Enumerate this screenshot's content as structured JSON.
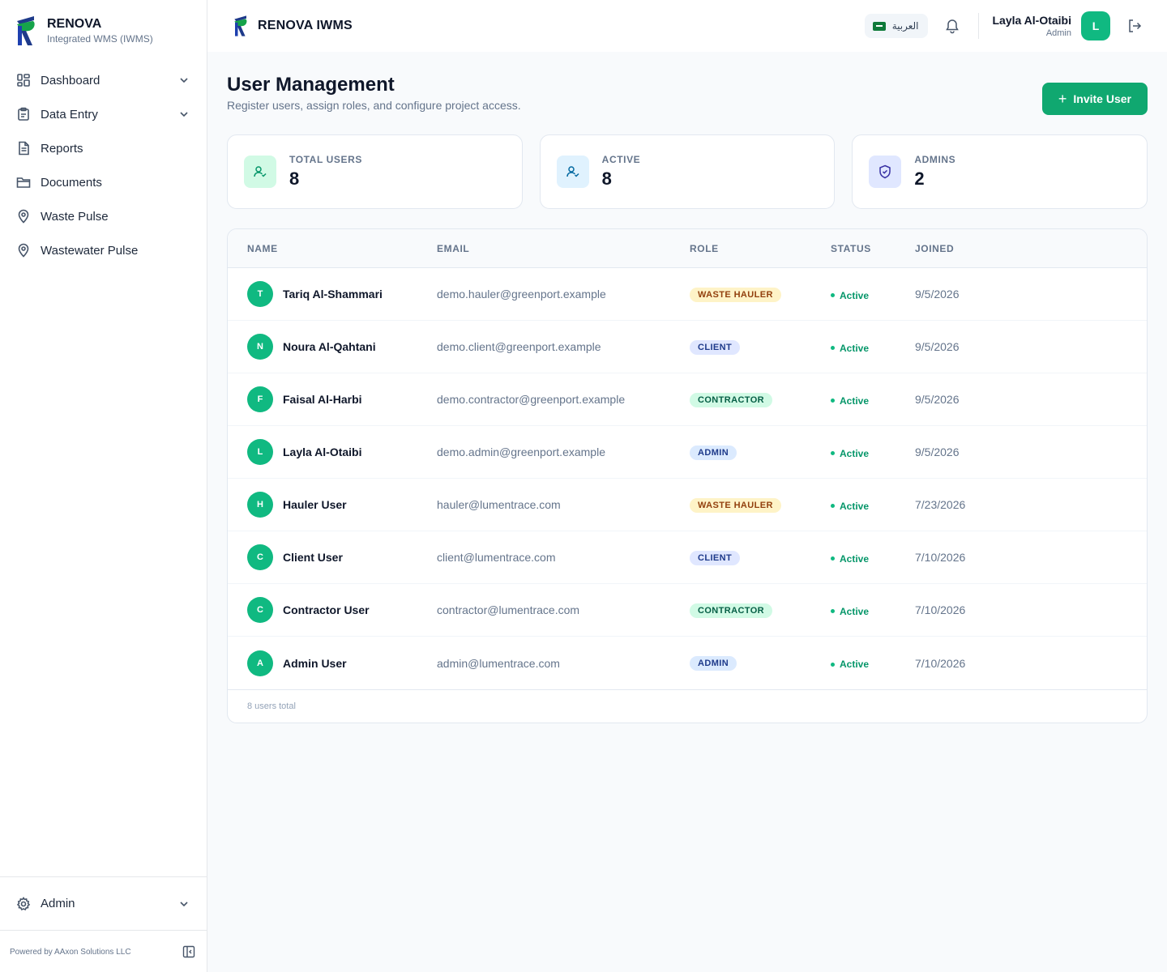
{
  "sidebar": {
    "brand_name": "RENOVA",
    "brand_sub": "Integrated WMS (IWMS)",
    "items": [
      {
        "label": "Dashboard"
      },
      {
        "label": "Data Entry"
      },
      {
        "label": "Reports"
      },
      {
        "label": "Documents"
      },
      {
        "label": "Waste Pulse"
      },
      {
        "label": "Wastewater Pulse"
      }
    ],
    "admin_label": "Admin",
    "footer": "Powered by AAxon Solutions LLC"
  },
  "header": {
    "brand_name": "RENOVA IWMS",
    "language": "العربية",
    "user_name": "Layla Al-Otaibi",
    "user_role": "Admin",
    "avatar_initial": "L"
  },
  "page": {
    "title": "User Management",
    "subtitle": "Register users, assign roles, and configure project access.",
    "invite_label": "Invite User"
  },
  "stats": [
    {
      "label": "TOTAL USERS",
      "value": "8"
    },
    {
      "label": "ACTIVE",
      "value": "8"
    },
    {
      "label": "ADMINS",
      "value": "2"
    }
  ],
  "table": {
    "columns": [
      "NAME",
      "EMAIL",
      "ROLE",
      "STATUS",
      "JOINED"
    ],
    "rows": [
      {
        "initial": "T",
        "name": "Tariq Al-Shammari",
        "email": "demo.hauler@greenport.example",
        "role": "WASTE HAULER",
        "status": "Active",
        "joined": "9/5/2026"
      },
      {
        "initial": "N",
        "name": "Noura Al-Qahtani",
        "email": "demo.client@greenport.example",
        "role": "CLIENT",
        "status": "Active",
        "joined": "9/5/2026"
      },
      {
        "initial": "F",
        "name": "Faisal Al-Harbi",
        "email": "demo.contractor@greenport.example",
        "role": "CONTRACTOR",
        "status": "Active",
        "joined": "9/5/2026"
      },
      {
        "initial": "L",
        "name": "Layla Al-Otaibi",
        "email": "demo.admin@greenport.example",
        "role": "ADMIN",
        "status": "Active",
        "joined": "9/5/2026"
      },
      {
        "initial": "H",
        "name": "Hauler User",
        "email": "hauler@lumentrace.com",
        "role": "WASTE HAULER",
        "status": "Active",
        "joined": "7/23/2026"
      },
      {
        "initial": "C",
        "name": "Client User",
        "email": "client@lumentrace.com",
        "role": "CLIENT",
        "status": "Active",
        "joined": "7/10/2026"
      },
      {
        "initial": "C",
        "name": "Contractor User",
        "email": "contractor@lumentrace.com",
        "role": "CONTRACTOR",
        "status": "Active",
        "joined": "7/10/2026"
      },
      {
        "initial": "A",
        "name": "Admin User",
        "email": "admin@lumentrace.com",
        "role": "ADMIN",
        "status": "Active",
        "joined": "7/10/2026"
      }
    ],
    "footer": "8 users total"
  },
  "colors": {
    "accent": "#10a870",
    "role_waste_hauler": {
      "bg": "#fef3c7",
      "fg": "#92400e"
    },
    "role_client": {
      "bg": "#e0e7ff",
      "fg": "#1e3a8a"
    },
    "role_contractor": {
      "bg": "#d1fae5",
      "fg": "#065f46"
    },
    "role_admin": {
      "bg": "#dbeafe",
      "fg": "#1e3a8a"
    }
  }
}
